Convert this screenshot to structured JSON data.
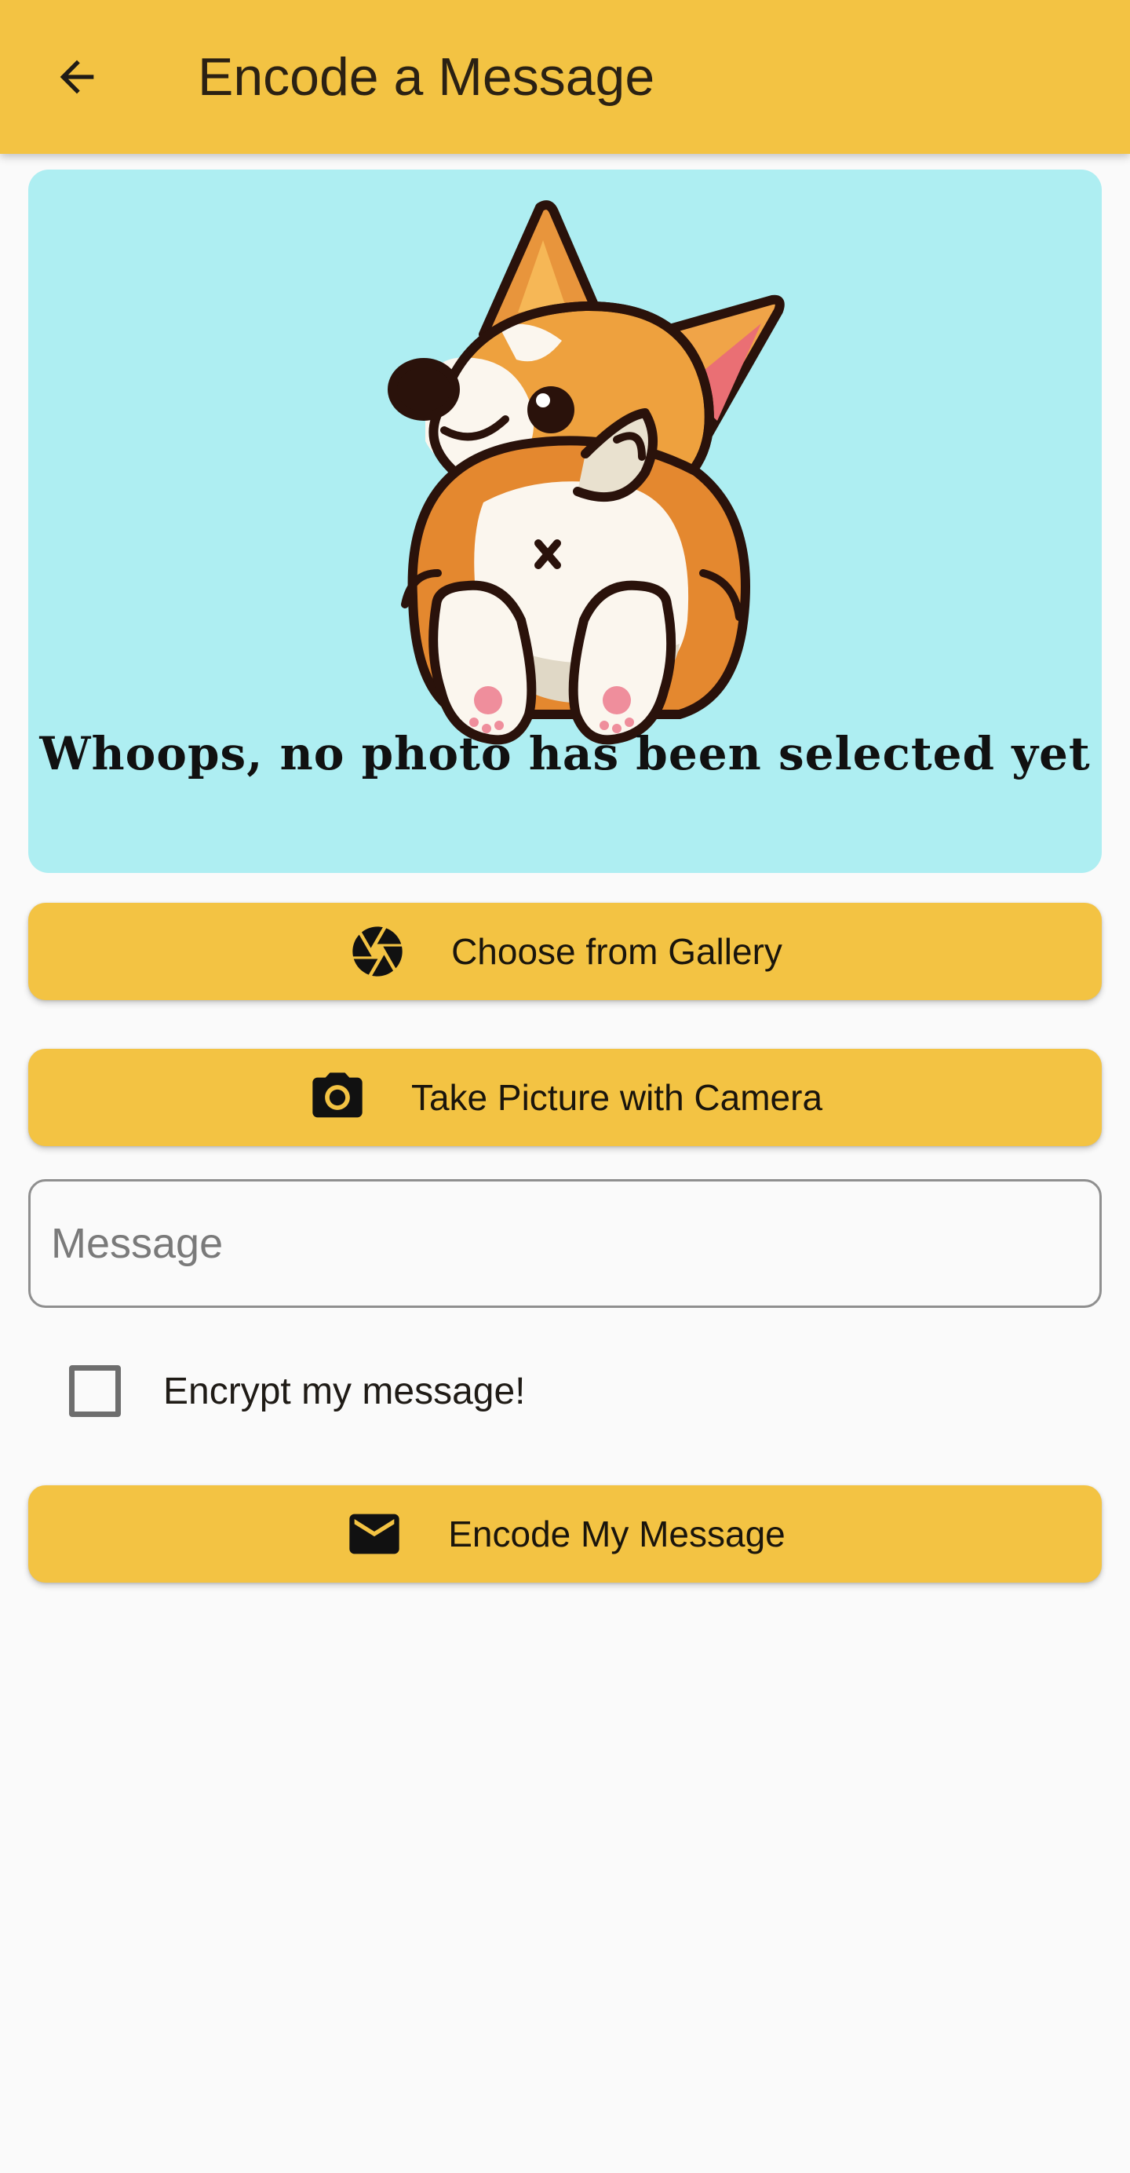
{
  "app_bar": {
    "title": "Encode a Message",
    "back_icon": "arrow-back-icon"
  },
  "placeholder": {
    "message": "Whoops, no photo has been selected yet",
    "illustration": "corgi-illustration"
  },
  "buttons": {
    "gallery": {
      "label": "Choose from Gallery",
      "icon": "camera-aperture-icon"
    },
    "camera": {
      "label": "Take Picture with Camera",
      "icon": "camera-icon"
    },
    "encode": {
      "label": "Encode My Message",
      "icon": "mail-icon"
    }
  },
  "message_input": {
    "value": "",
    "placeholder": "Message"
  },
  "encrypt_option": {
    "label": "Encrypt my message!",
    "checked": false
  },
  "colors": {
    "accent": "#f3c343",
    "card_background": "#aeeef2",
    "page_background": "#fafafa"
  }
}
